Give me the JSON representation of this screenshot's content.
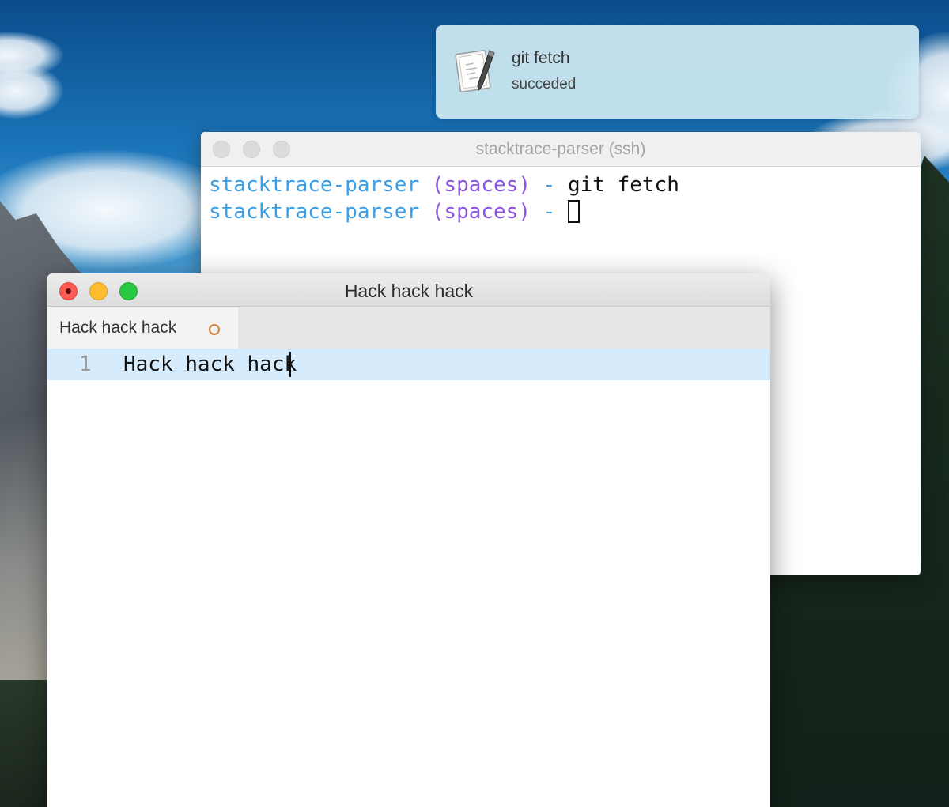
{
  "notification": {
    "icon": "script-editor-icon",
    "title": "git fetch",
    "body": "succeded"
  },
  "terminal": {
    "title": "stacktrace-parser (ssh)",
    "lines": [
      {
        "dir": "stacktrace-parser",
        "branch": "(spaces)",
        "sep": "-",
        "command": "git fetch"
      },
      {
        "dir": "stacktrace-parser",
        "branch": "(spaces)",
        "sep": "-",
        "command": ""
      }
    ],
    "colors": {
      "dir": "#3a9ee5",
      "branch": "#8a54e0"
    }
  },
  "editor": {
    "title": "Hack hack hack",
    "tab": {
      "label": "Hack hack hack",
      "modified": true
    },
    "lines": [
      {
        "number": "1",
        "text": "Hack hack hack"
      }
    ],
    "colors": {
      "current_line": "#d6ebfb",
      "modified_dot": "#d5813e"
    }
  }
}
